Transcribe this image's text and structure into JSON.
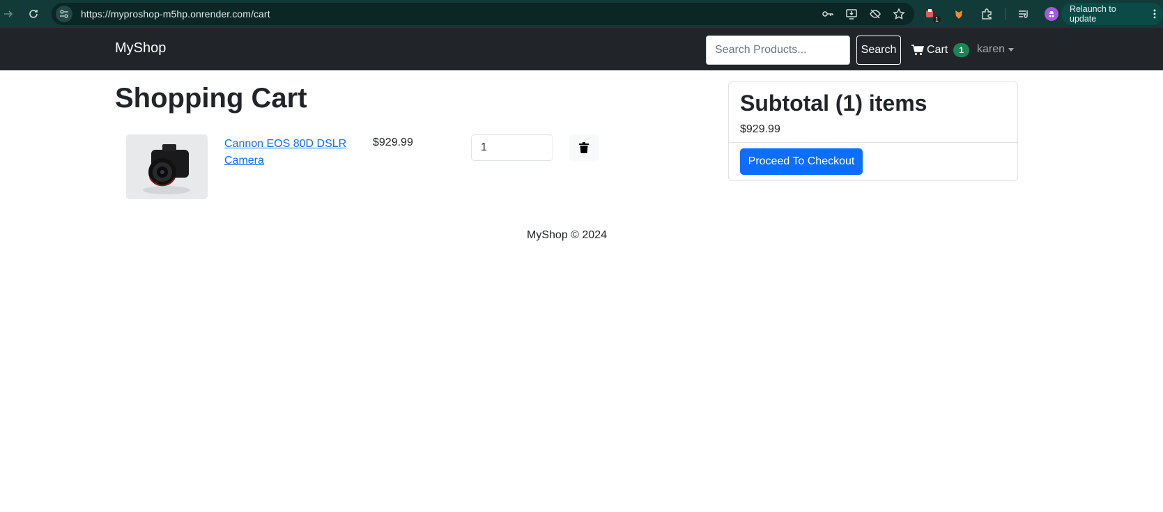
{
  "browser": {
    "url": "https://myproshop-m5hp.onrender.com/cart",
    "relaunch_label": "Relaunch to update",
    "extension_badge": "1"
  },
  "navbar": {
    "brand": "MyShop",
    "search_placeholder": "Search Products...",
    "search_button": "Search",
    "cart_label": "Cart",
    "cart_count": "1",
    "user_name": "karen"
  },
  "cart": {
    "title": "Shopping Cart",
    "items": [
      {
        "name": "Cannon EOS 80D DSLR Camera",
        "price": "$929.99",
        "quantity": "1",
        "image_icon": "camera-product-image"
      }
    ]
  },
  "summary": {
    "title": "Subtotal (1) items",
    "total": "$929.99",
    "checkout_button": "Proceed To Checkout"
  },
  "footer": {
    "text": "MyShop © 2024"
  },
  "colors": {
    "browser_bar": "#113a38",
    "navbar": "#212529",
    "primary": "#0d6efd",
    "badge": "#198754"
  }
}
